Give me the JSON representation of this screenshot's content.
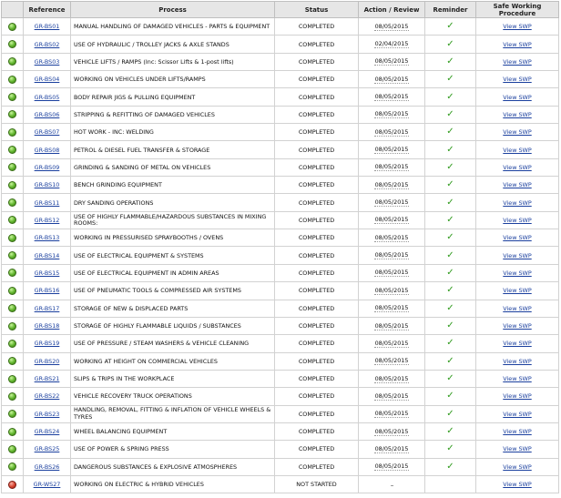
{
  "colors": {
    "status_ok": "#5fb32c",
    "status_not_started": "#d8432f",
    "link": "#1a3f9e",
    "tick": "#2f9a1d"
  },
  "columns": [
    "Reference",
    "Process",
    "Status",
    "Action / Review",
    "Reminder",
    "Safe Working Procedure"
  ],
  "rows": [
    {
      "status_icon": "green",
      "reference": "GR-BS01",
      "process": "MANUAL HANDLING OF DAMAGED VEHICLES - PARTS & EQUIPMENT",
      "status": "COMPLETED",
      "review": "08/05/2015",
      "reminder": "✓",
      "swp": "View SWP"
    },
    {
      "status_icon": "green",
      "reference": "GR-BS02",
      "process": "USE OF HYDRAULIC / TROLLEY JACKS & AXLE STANDS",
      "status": "COMPLETED",
      "review": "02/04/2015",
      "reminder": "✓",
      "swp": "View SWP"
    },
    {
      "status_icon": "green",
      "reference": "GR-BS03",
      "process": "VEHICLE LIFTS / RAMPS (Inc: Scissor Lifts & 1-post lifts)",
      "status": "COMPLETED",
      "review": "08/05/2015",
      "reminder": "✓",
      "swp": "View SWP"
    },
    {
      "status_icon": "green",
      "reference": "GR-BS04",
      "process": "WORKING ON VEHICLES UNDER LIFTS/RAMPS",
      "status": "COMPLETED",
      "review": "08/05/2015",
      "reminder": "✓",
      "swp": "View SWP"
    },
    {
      "status_icon": "green",
      "reference": "GR-BS05",
      "process": "BODY REPAIR JIGS & PULLING EQUIPMENT",
      "status": "COMPLETED",
      "review": "08/05/2015",
      "reminder": "✓",
      "swp": "View SWP"
    },
    {
      "status_icon": "green",
      "reference": "GR-BS06",
      "process": "STRIPPING & REFITTING OF DAMAGED VEHICLES",
      "status": "COMPLETED",
      "review": "08/05/2015",
      "reminder": "✓",
      "swp": "View SWP"
    },
    {
      "status_icon": "green",
      "reference": "GR-BS07",
      "process": "HOT WORK - INC: WELDING",
      "status": "COMPLETED",
      "review": "08/05/2015",
      "reminder": "✓",
      "swp": "View SWP"
    },
    {
      "status_icon": "green",
      "reference": "GR-BS08",
      "process": "PETROL & DIESEL FUEL TRANSFER & STORAGE",
      "status": "COMPLETED",
      "review": "08/05/2015",
      "reminder": "✓",
      "swp": "View SWP"
    },
    {
      "status_icon": "green",
      "reference": "GR-BS09",
      "process": "GRINDING & SANDING OF METAL ON VEHICLES",
      "status": "COMPLETED",
      "review": "08/05/2015",
      "reminder": "✓",
      "swp": "View SWP"
    },
    {
      "status_icon": "green",
      "reference": "GR-BS10",
      "process": "BENCH GRINDING EQUIPMENT",
      "status": "COMPLETED",
      "review": "08/05/2015",
      "reminder": "✓",
      "swp": "View SWP"
    },
    {
      "status_icon": "green",
      "reference": "GR-BS11",
      "process": "DRY SANDING OPERATIONS",
      "status": "COMPLETED",
      "review": "08/05/2015",
      "reminder": "✓",
      "swp": "View SWP"
    },
    {
      "status_icon": "green",
      "reference": "GR-BS12",
      "process": "USE OF HIGHLY FLAMMABLE/HAZARDOUS SUBSTANCES IN MIXING ROOMS:",
      "status": "COMPLETED",
      "review": "08/05/2015",
      "reminder": "✓",
      "swp": "View SWP"
    },
    {
      "status_icon": "green",
      "reference": "GR-BS13",
      "process": "WORKING IN PRESSURISED SPRAYBOOTHS / OVENS",
      "status": "COMPLETED",
      "review": "08/05/2015",
      "reminder": "✓",
      "swp": "View SWP"
    },
    {
      "status_icon": "green",
      "reference": "GR-BS14",
      "process": "USE OF ELECTRICAL EQUIPMENT & SYSTEMS",
      "status": "COMPLETED",
      "review": "08/05/2015",
      "reminder": "✓",
      "swp": "View SWP"
    },
    {
      "status_icon": "green",
      "reference": "GR-BS15",
      "process": "USE OF ELECTRICAL EQUIPMENT IN ADMIN AREAS",
      "status": "COMPLETED",
      "review": "08/05/2015",
      "reminder": "✓",
      "swp": "View SWP"
    },
    {
      "status_icon": "green",
      "reference": "GR-BS16",
      "process": "USE OF PNEUMATIC TOOLS & COMPRESSED AIR SYSTEMS",
      "status": "COMPLETED",
      "review": "08/05/2015",
      "reminder": "✓",
      "swp": "View SWP"
    },
    {
      "status_icon": "green",
      "reference": "GR-BS17",
      "process": "STORAGE OF NEW & DISPLACED PARTS",
      "status": "COMPLETED",
      "review": "08/05/2015",
      "reminder": "✓",
      "swp": "View SWP"
    },
    {
      "status_icon": "green",
      "reference": "GR-BS18",
      "process": "STORAGE OF HIGHLY FLAMMABLE LIQUIDS / SUBSTANCES",
      "status": "COMPLETED",
      "review": "08/05/2015",
      "reminder": "✓",
      "swp": "View SWP"
    },
    {
      "status_icon": "green",
      "reference": "GR-BS19",
      "process": "USE OF PRESSURE / STEAM WASHERS & VEHICLE CLEANING",
      "status": "COMPLETED",
      "review": "08/05/2015",
      "reminder": "✓",
      "swp": "View SWP"
    },
    {
      "status_icon": "green",
      "reference": "GR-BS20",
      "process": "WORKING AT HEIGHT ON COMMERCIAL VEHICLES",
      "status": "COMPLETED",
      "review": "08/05/2015",
      "reminder": "✓",
      "swp": "View SWP"
    },
    {
      "status_icon": "green",
      "reference": "GR-BS21",
      "process": "SLIPS & TRIPS IN THE WORKPLACE",
      "status": "COMPLETED",
      "review": "08/05/2015",
      "reminder": "✓",
      "swp": "View SWP"
    },
    {
      "status_icon": "green",
      "reference": "GR-BS22",
      "process": "VEHICLE RECOVERY TRUCK OPERATIONS",
      "status": "COMPLETED",
      "review": "08/05/2015",
      "reminder": "✓",
      "swp": "View SWP"
    },
    {
      "status_icon": "green",
      "reference": "GR-BS23",
      "process": "HANDLING, REMOVAL, FITTING & INFLATION OF VEHICLE WHEELS & TYRES",
      "status": "COMPLETED",
      "review": "08/05/2015",
      "reminder": "✓",
      "swp": "View SWP"
    },
    {
      "status_icon": "green",
      "reference": "GR-BS24",
      "process": "WHEEL BALANCING EQUIPMENT",
      "status": "COMPLETED",
      "review": "08/05/2015",
      "reminder": "✓",
      "swp": "View SWP"
    },
    {
      "status_icon": "green",
      "reference": "GR-BS25",
      "process": "USE OF POWER & SPRING PRESS",
      "status": "COMPLETED",
      "review": "08/05/2015",
      "reminder": "✓",
      "swp": "View SWP"
    },
    {
      "status_icon": "green",
      "reference": "GR-BS26",
      "process": "DANGEROUS SUBSTANCES & EXPLOSIVE ATMOSPHERES",
      "status": "COMPLETED",
      "review": "08/05/2015",
      "reminder": "✓",
      "swp": "View SWP"
    },
    {
      "status_icon": "red",
      "reference": "GR-WS27",
      "process": "WORKING ON ELECTRIC & HYBRID VEHICLES",
      "status": "NOT STARTED",
      "review": "",
      "reminder": "",
      "swp": "View SWP"
    }
  ]
}
